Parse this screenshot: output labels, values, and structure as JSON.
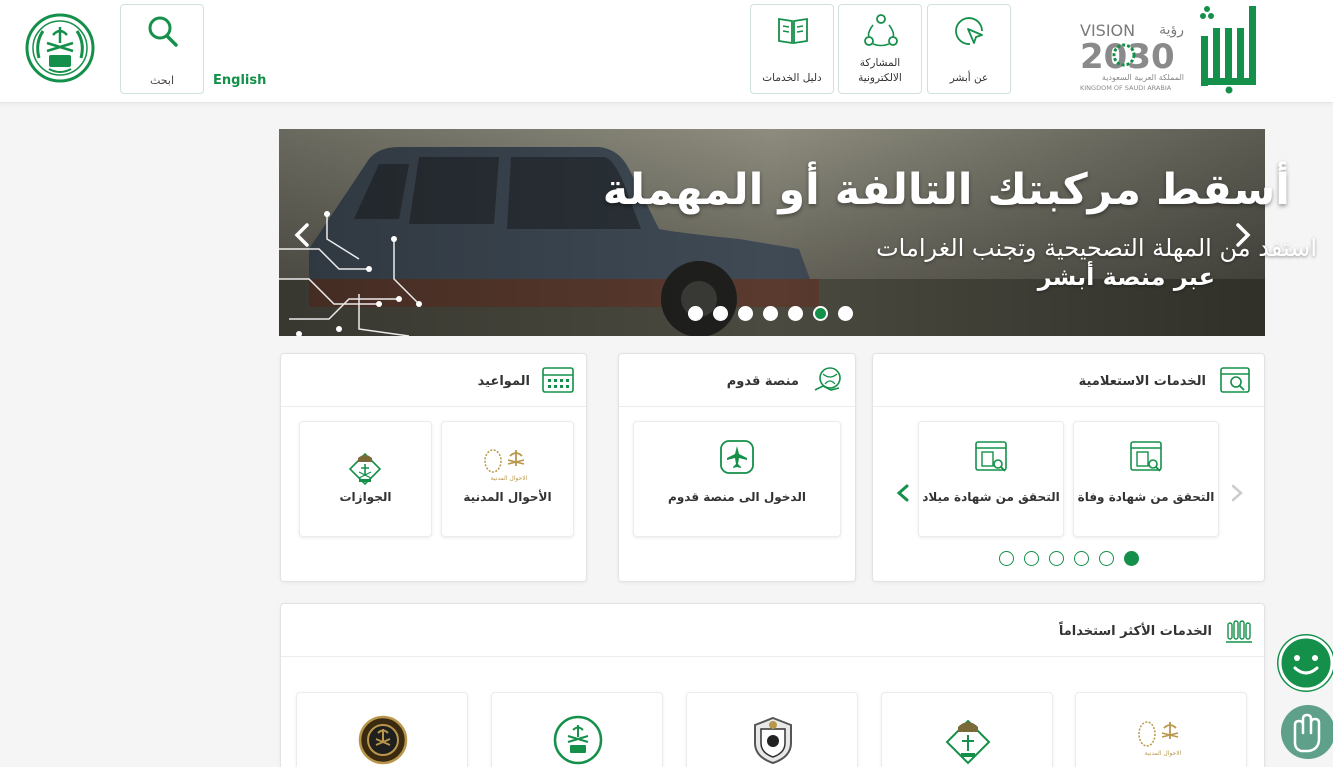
{
  "header": {
    "search_label": "ابحث",
    "language_label": "English",
    "nav": [
      {
        "label": "دليل الخدمات"
      },
      {
        "label": "المشاركة الالكترونية"
      },
      {
        "label": "عن أبشر"
      }
    ],
    "vision_line1": "VISION",
    "vision_arabic": "رؤية",
    "vision_year": "2030",
    "vision_kingdom_ar": "المملكة العربية السعودية",
    "vision_kingdom_en": "KINGDOM OF SAUDI ARABIA"
  },
  "banner": {
    "title": "أسقط مركبتك التالفة أو المهملة",
    "subtitle": "استفد من المهلة التصحيحية وتجنب الغرامات",
    "subtitle2": "عبر منصة أبشر",
    "slide_count": 7,
    "active_slide_index": 5
  },
  "inquiry": {
    "title": "الخدمات الاستعلامية",
    "tiles": [
      {
        "label": "التحقق من شهادة وفاة"
      },
      {
        "label": "التحقق من شهادة ميلاد"
      }
    ],
    "page_count": 6,
    "active_page_index": 5
  },
  "qudoom": {
    "title": "منصة قدوم",
    "tile_label": "الدخول الى منصة قدوم"
  },
  "appointments": {
    "title": "المواعيد",
    "tiles": [
      {
        "label": "الأحوال المدنية",
        "logo_text": "الاحوال المدنية"
      },
      {
        "label": "الجوازات"
      }
    ]
  },
  "most_used": {
    "title": "الخدمات الأكثر استخداماً",
    "logo_text_civil": "الاحوال المدنية"
  },
  "colors": {
    "brand_green": "#14904a",
    "gold": "#b8974a"
  }
}
